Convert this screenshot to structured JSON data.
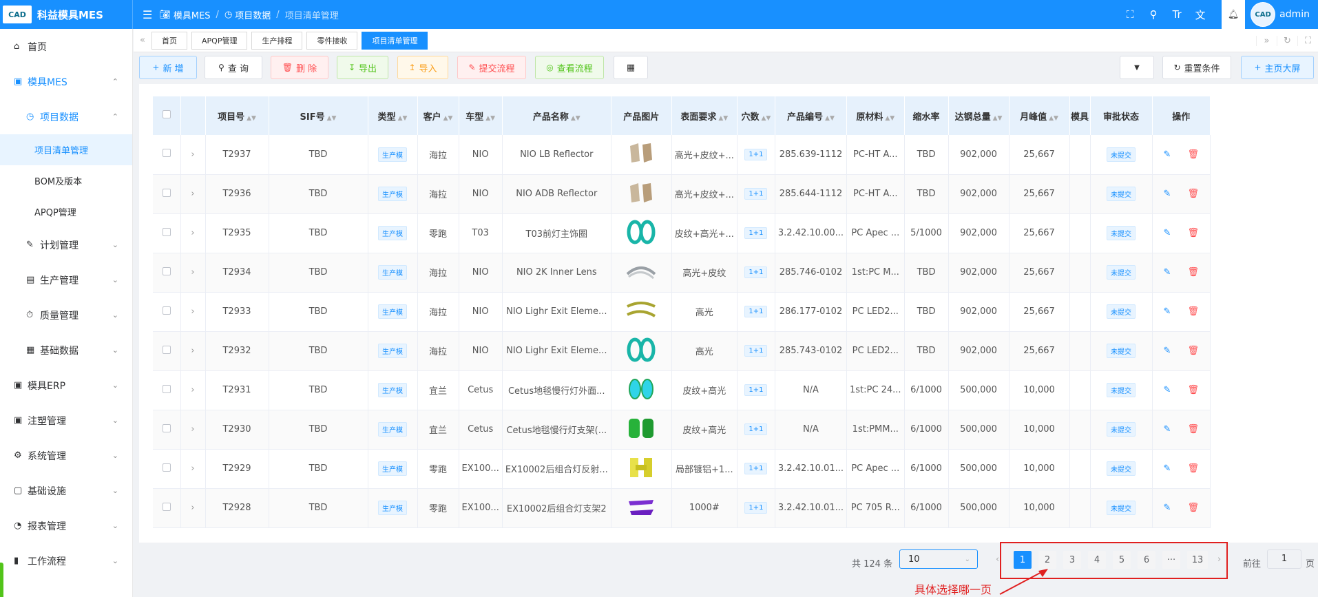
{
  "brand": {
    "logo_text": "CAD",
    "app_name": "科益模具MES"
  },
  "breadcrumb": [
    "模具MES",
    "项目数据",
    "项目清单管理"
  ],
  "user": {
    "name": "admin",
    "avatar_text": "CAD"
  },
  "sidebar": {
    "items": [
      {
        "label": "首页"
      },
      {
        "label": "模具MES"
      },
      {
        "label": "项目数据"
      },
      {
        "label": "项目清单管理"
      },
      {
        "label": "BOM及版本"
      },
      {
        "label": "APQP管理"
      },
      {
        "label": "计划管理"
      },
      {
        "label": "生产管理"
      },
      {
        "label": "质量管理"
      },
      {
        "label": "基础数据"
      },
      {
        "label": "模具ERP"
      },
      {
        "label": "注塑管理"
      },
      {
        "label": "系统管理"
      },
      {
        "label": "基础设施"
      },
      {
        "label": "报表管理"
      },
      {
        "label": "工作流程"
      }
    ]
  },
  "tabs": [
    "首页",
    "APQP管理",
    "生产排程",
    "零件接收",
    "项目清单管理"
  ],
  "toolbar": {
    "add": "新 增",
    "query": "查 询",
    "delete": "删 除",
    "export": "导出",
    "import": "导入",
    "submit_flow": "提交流程",
    "view_flow": "查看流程",
    "reset": "重置条件",
    "dashboard": "主页大屏"
  },
  "colors": {
    "primary": "#1890ff",
    "danger": "#ff4d4f",
    "annotation": "#e02020"
  },
  "table": {
    "headers": [
      "项目号",
      "SIF号",
      "类型",
      "客户",
      "车型",
      "产品名称",
      "产品图片",
      "表面要求",
      "穴数",
      "产品编号",
      "原材料",
      "缩水率",
      "达钢总量",
      "月峰值",
      "模具",
      "审批状态",
      "操作"
    ],
    "rows": [
      {
        "id": "T2937",
        "sif": "TBD",
        "type": "生产模",
        "customer": "海拉",
        "car": "NIO",
        "name": "NIO LB Reflector",
        "surface": "高光+皮纹+...",
        "cavity": "1+1",
        "code": "285.639-1112",
        "material": "PC-HT A...",
        "shrink": "TBD",
        "total": "902,000",
        "peak": "25,667",
        "status": "未提交",
        "img": "beige"
      },
      {
        "id": "T2936",
        "sif": "TBD",
        "type": "生产模",
        "customer": "海拉",
        "car": "NIO",
        "name": "NIO ADB Reflector",
        "surface": "高光+皮纹+...",
        "cavity": "1+1",
        "code": "285.644-1112",
        "material": "PC-HT A...",
        "shrink": "TBD",
        "total": "902,000",
        "peak": "25,667",
        "status": "未提交",
        "img": "beige"
      },
      {
        "id": "T2935",
        "sif": "TBD",
        "type": "生产模",
        "customer": "零跑",
        "car": "T03",
        "name": "T03前灯主饰圈",
        "surface": "皮纹+高光+...",
        "cavity": "1+1",
        "code": "3.2.42.10.00...",
        "material": "PC Apec ...",
        "shrink": "5/1000",
        "total": "902,000",
        "peak": "25,667",
        "status": "未提交",
        "img": "teal"
      },
      {
        "id": "T2934",
        "sif": "TBD",
        "type": "生产模",
        "customer": "海拉",
        "car": "NIO",
        "name": "NIO 2K Inner Lens",
        "surface": "高光+皮纹",
        "cavity": "1+1",
        "code": "285.746-0102",
        "material": "1st:PC M...",
        "shrink": "TBD",
        "total": "902,000",
        "peak": "25,667",
        "status": "未提交",
        "img": "gray"
      },
      {
        "id": "T2933",
        "sif": "TBD",
        "type": "生产模",
        "customer": "海拉",
        "car": "NIO",
        "name": "NIO Lighr Exit Eleme...",
        "surface": "高光",
        "cavity": "1+1",
        "code": "286.177-0102",
        "material": "PC LED2...",
        "shrink": "TBD",
        "total": "902,000",
        "peak": "25,667",
        "status": "未提交",
        "img": "olive"
      },
      {
        "id": "T2932",
        "sif": "TBD",
        "type": "生产模",
        "customer": "海拉",
        "car": "NIO",
        "name": "NIO Lighr Exit Eleme...",
        "surface": "高光",
        "cavity": "1+1",
        "code": "285.743-0102",
        "material": "PC LED2...",
        "shrink": "TBD",
        "total": "902,000",
        "peak": "25,667",
        "status": "未提交",
        "img": "teal"
      },
      {
        "id": "T2931",
        "sif": "TBD",
        "type": "生产模",
        "customer": "宜兰",
        "car": "Cetus",
        "name": "Cetus地毯慢行灯外面...",
        "surface": "皮纹+高光",
        "cavity": "1+1",
        "code": "N/A",
        "material": "1st:PC 24...",
        "shrink": "6/1000",
        "total": "500,000",
        "peak": "10,000",
        "status": "未提交",
        "img": "cyan"
      },
      {
        "id": "T2930",
        "sif": "TBD",
        "type": "生产模",
        "customer": "宜兰",
        "car": "Cetus",
        "name": "Cetus地毯慢行灯支架(...",
        "surface": "皮纹+高光",
        "cavity": "1+1",
        "code": "N/A",
        "material": "1st:PMM...",
        "shrink": "6/1000",
        "total": "500,000",
        "peak": "10,000",
        "status": "未提交",
        "img": "green"
      },
      {
        "id": "T2929",
        "sif": "TBD",
        "type": "生产模",
        "customer": "零跑",
        "car": "EX100...",
        "name": "EX10002后组合灯反射...",
        "surface": "局部镀铝+1...",
        "cavity": "1+1",
        "code": "3.2.42.10.01...",
        "material": "PC Apec ...",
        "shrink": "6/1000",
        "total": "500,000",
        "peak": "10,000",
        "status": "未提交",
        "img": "yellow"
      },
      {
        "id": "T2928",
        "sif": "TBD",
        "type": "生产模",
        "customer": "零跑",
        "car": "EX100...",
        "name": "EX10002后组合灯支架2",
        "surface": "1000#",
        "cavity": "1+1",
        "code": "3.2.42.10.01...",
        "material": "PC 705 R...",
        "shrink": "6/1000",
        "total": "500,000",
        "peak": "10,000",
        "status": "未提交",
        "img": "purple"
      }
    ]
  },
  "pagination": {
    "total": "共 124 条",
    "page_size": "10",
    "pages": [
      "1",
      "2",
      "3",
      "4",
      "5",
      "6",
      "···",
      "13"
    ],
    "current": "1",
    "goto_label": "前往",
    "goto_value": "1",
    "page_unit": "页"
  },
  "annotation": "具体选择哪一页"
}
